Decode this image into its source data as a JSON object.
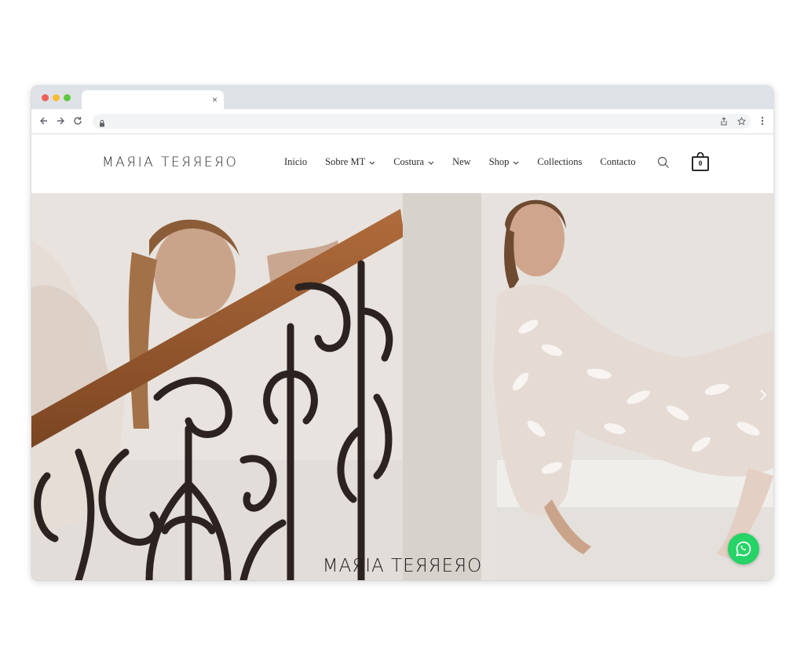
{
  "browser": {
    "tab": {
      "close_label": "×"
    }
  },
  "site": {
    "logo": "MAЯIA TEЯЯEЯO",
    "nav": [
      {
        "label": "Inicio",
        "has_dropdown": false
      },
      {
        "label": "Sobre MT",
        "has_dropdown": true
      },
      {
        "label": "Costura",
        "has_dropdown": true
      },
      {
        "label": "New",
        "has_dropdown": false
      },
      {
        "label": "Shop",
        "has_dropdown": true
      },
      {
        "label": "Collections",
        "has_dropdown": false
      },
      {
        "label": "Contacto",
        "has_dropdown": false
      }
    ],
    "cart_count": "0"
  },
  "hero": {
    "overlay_logo": "MAЯIA TEЯЯEЯO",
    "next_arrow": "›"
  },
  "icons": {
    "back": "back-arrow-icon",
    "forward": "forward-arrow-icon",
    "reload": "reload-icon",
    "lock": "lock-icon",
    "share": "share-icon",
    "bookmark": "star-icon",
    "menu": "kebab-menu-icon",
    "search": "search-icon",
    "cart": "shopping-bag-icon",
    "whatsapp": "whatsapp-icon"
  },
  "colors": {
    "whatsapp": "#25d366",
    "text": "#2b2b2b",
    "tabstrip": "#dee1e6"
  }
}
